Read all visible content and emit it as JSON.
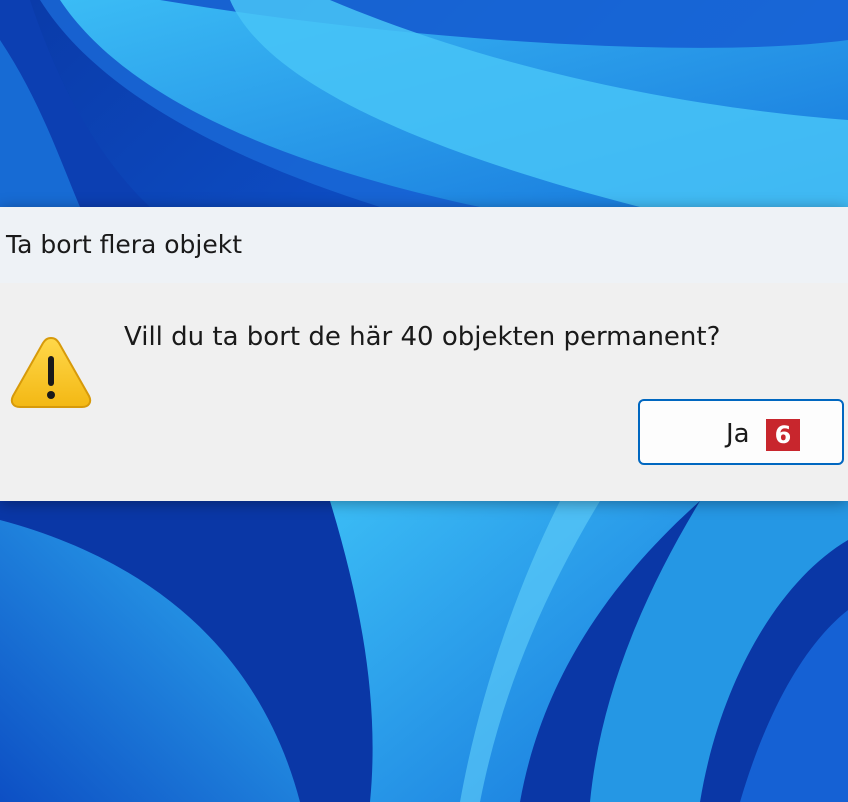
{
  "dialog": {
    "title": "Ta bort flera objekt",
    "message": "Vill du ta bort de här 40 objekten permanent?",
    "icon": "warning-icon",
    "yes_button_label": "Ja"
  },
  "annotation": {
    "step_number": "6",
    "badge_color": "#c8262d"
  },
  "colors": {
    "wallpaper_dark": "#0b3fb8",
    "wallpaper_light": "#2aa8ef",
    "dialog_background": "#f0f0f0",
    "button_border": "#0067c0",
    "warning_yellow": "#f8c81e"
  }
}
